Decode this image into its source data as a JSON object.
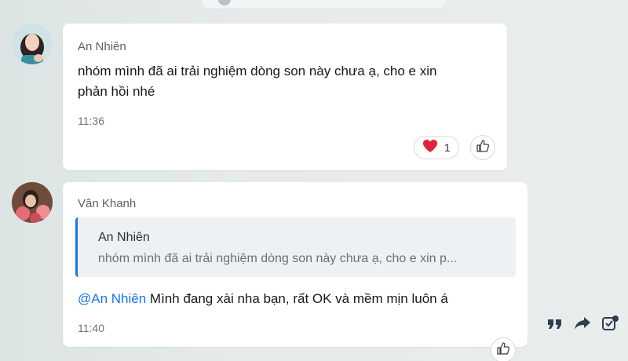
{
  "messages": [
    {
      "sender": "An Nhiên",
      "text": "nhóm mình đã ai trải nghiệm dòng son này chưa ạ, cho e xin phản hồi nhé",
      "line1": "nhóm mình đã ai trải nghiệm dòng son này chưa ạ, cho e xin",
      "line2": "phản hồi nhé",
      "time": "11:36",
      "reaction": {
        "icon": "heart-icon",
        "count": "1"
      }
    },
    {
      "sender": "Vân Khanh",
      "quote": {
        "sender": "An Nhiên",
        "text": "nhóm mình đã ai trải nghiệm dòng son này chưa ạ, cho e xin p..."
      },
      "mention": "@An Nhiên",
      "text": " Mình đang xài nha bạn, rất OK và mềm mịn luôn á",
      "time": "11:40"
    }
  ],
  "actions": {
    "quote_icon": "quote-icon",
    "forward_icon": "forward-icon",
    "more_icon": "checkbox-edit-icon",
    "like_icon": "thumbs-up-icon"
  },
  "colors": {
    "accent": "#1a73e8",
    "heart": "#e0233c",
    "bubble": "#ffffff",
    "quote_bg": "#eef1f4"
  }
}
